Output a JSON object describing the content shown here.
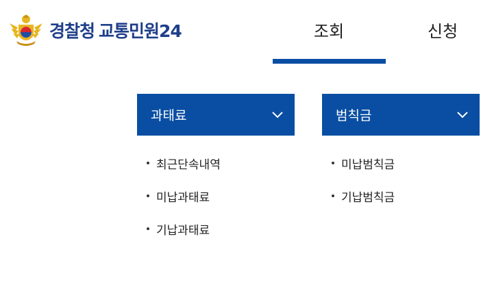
{
  "header": {
    "logo_org": "경찰청",
    "logo_service": "교통민원24",
    "emblem_icon": "police-emblem-icon",
    "nav_tabs": [
      {
        "label": "조회",
        "active": true
      },
      {
        "label": "신청",
        "active": false
      }
    ]
  },
  "menus": [
    {
      "title": "과태료",
      "chevron_icon": "chevron-down-icon",
      "items": [
        "최근단속내역",
        "미납과태료",
        "기납과태료"
      ]
    },
    {
      "title": "범칙금",
      "chevron_icon": "chevron-down-icon",
      "items": [
        "미납범칙금",
        "기납범칙금"
      ]
    }
  ],
  "colors": {
    "accent": "#0a4ea3",
    "logo_text": "#1f3f8a",
    "emblem_gold": "#e7b51f",
    "text": "#222222"
  }
}
